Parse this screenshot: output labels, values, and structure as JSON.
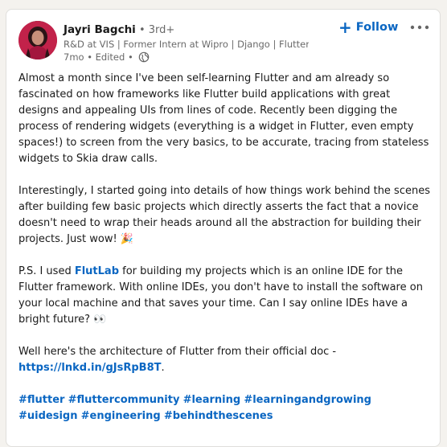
{
  "post": {
    "author": {
      "name": "Jayri Bagchi",
      "degree": " • 3rd+",
      "headline": "R&D at VIS | Former Intern at Wipro | Django | Flutter |…",
      "time": "7mo",
      "edited": " • Edited • ",
      "avatar_icon": "avatar-photo",
      "visibility_icon": "globe-icon"
    },
    "follow_label": "Follow",
    "more_icon": "ellipsis-icon",
    "paragraph1": "Almost a month since I've been self-learning Flutter and am already so fascinated on how frameworks like Flutter build applications with great designs and appealing UIs from lines of code. Recently been digging the process of rendering widgets (everything is a widget in Flutter, even empty spaces!) to screen from the very basics, to be accurate, tracing from stateless widgets to Skia draw calls.",
    "paragraph2": "Interestingly, I started going into details of how things work behind the scenes after building few basic projects which directly asserts the fact that a novice doesn't need to wrap their heads around all the abstraction for building their projects. Just wow! 🎉",
    "paragraph3_pre": "P.S. I used ",
    "paragraph3_link": "FlutLab",
    "paragraph3_post": " for building my projects which is an online IDE for the Flutter framework. With online IDEs, you don't have to install the software on your local machine and that saves your time. Can I say online IDEs have a bright future? 👀",
    "paragraph4_pre": "Well here's the architecture of Flutter from their official doc - ",
    "paragraph4_link": "https://lnkd.in/gJsRpB8T",
    "paragraph4_post": ".",
    "hashtags": [
      "#flutter",
      "#fluttercommunity",
      "#learning",
      "#learningandgrowing",
      "#uidesign",
      "#engineering",
      "#behindthescenes"
    ]
  },
  "colors": {
    "accent": "#0a66c2",
    "background": "#f4f2ee",
    "card": "#ffffff"
  }
}
